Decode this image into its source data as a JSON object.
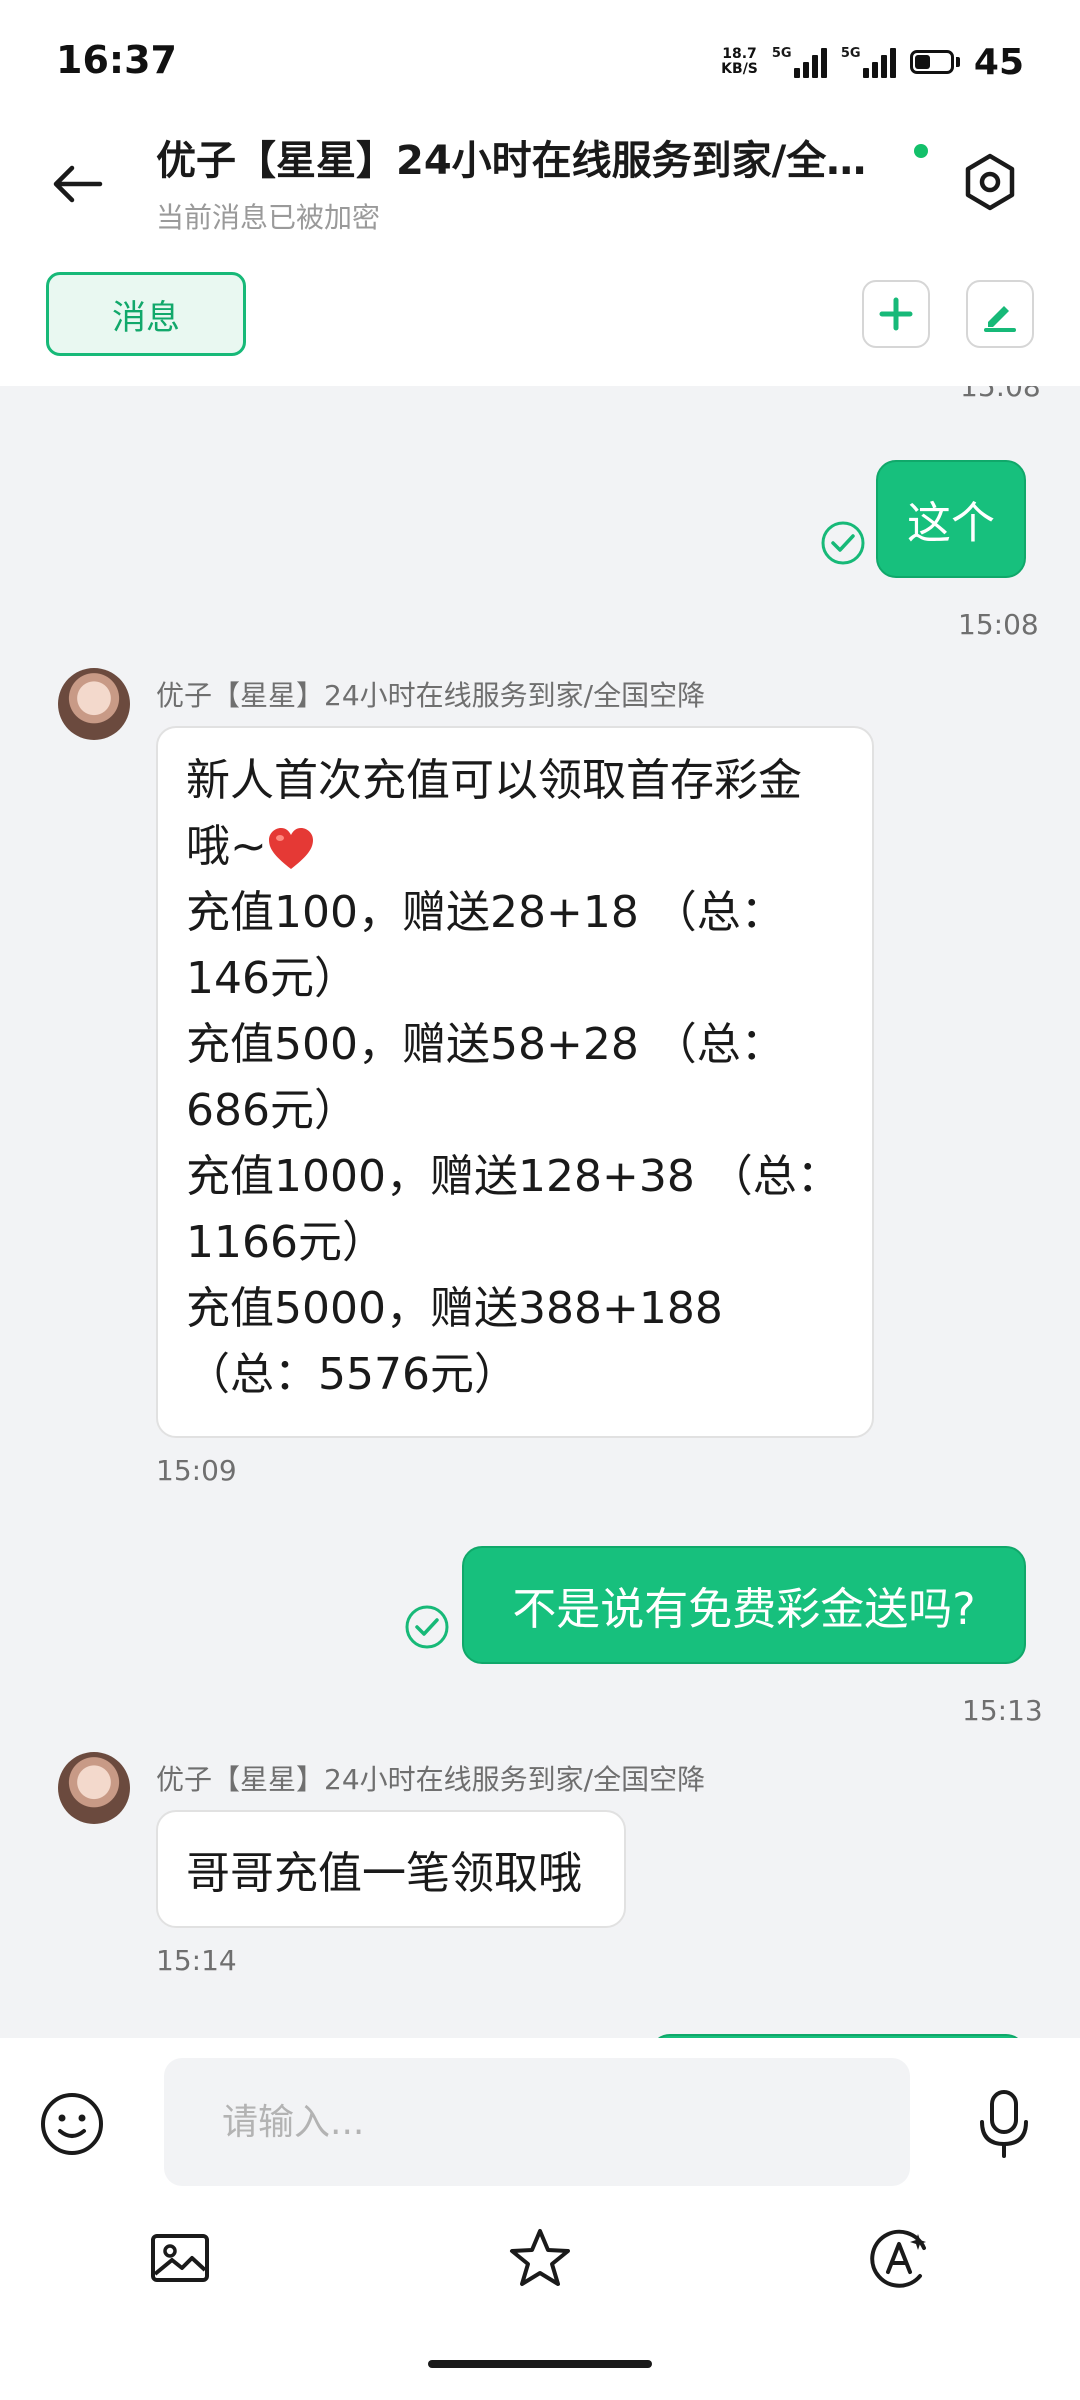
{
  "status_bar": {
    "time": "16:37",
    "net_speed_value": "18.7",
    "net_speed_unit": "KB/S",
    "sim1_label": "5G",
    "sim2_label": "5G",
    "battery_level": "45"
  },
  "header": {
    "title": "优子【星星】24小时在线服务到家/全国...",
    "subtitle": "当前消息已被加密",
    "online_color": "#13c06a"
  },
  "toolbar": {
    "messages_tab": "消息"
  },
  "chat": {
    "top_timestamp": "15:08",
    "messages": [
      {
        "direction": "out",
        "text": "这个",
        "timestamp": "15:08"
      },
      {
        "direction": "in",
        "sender": "优子【星星】24小时在线服务到家/全国空降",
        "lines": [
          "新人首次充值可以领取首存彩金",
          "哦~",
          "充值100，赠送28+18 （总：",
          "146元）",
          "充值500，赠送58+28 （总：",
          "686元）",
          "充值1000，赠送128+38 （总：",
          "1166元）",
          "充值5000，赠送388+188",
          "（总：5576元）"
        ],
        "timestamp": "15:09"
      },
      {
        "direction": "out",
        "text": "不是说有免费彩金送吗?",
        "timestamp": "15:13"
      },
      {
        "direction": "in",
        "sender": "优子【星星】24小时在线服务到家/全国空降",
        "text": "哥哥充值一笔领取哦",
        "timestamp": "15:14"
      }
    ]
  },
  "input": {
    "placeholder": "请输入..."
  },
  "icons": {
    "back": "arrow-left-icon",
    "settings": "hexagon-settings-icon",
    "add": "plus-icon",
    "edit": "pencil-icon",
    "emoji": "smiley-icon",
    "mic": "microphone-icon",
    "image": "image-icon",
    "favorite": "star-icon",
    "ai": "ai-assistant-icon",
    "sent": "check-circle-icon",
    "heart": "heart-emoji"
  },
  "colors": {
    "accent": "#17c07d",
    "chat_background": "#f2f3f5"
  }
}
